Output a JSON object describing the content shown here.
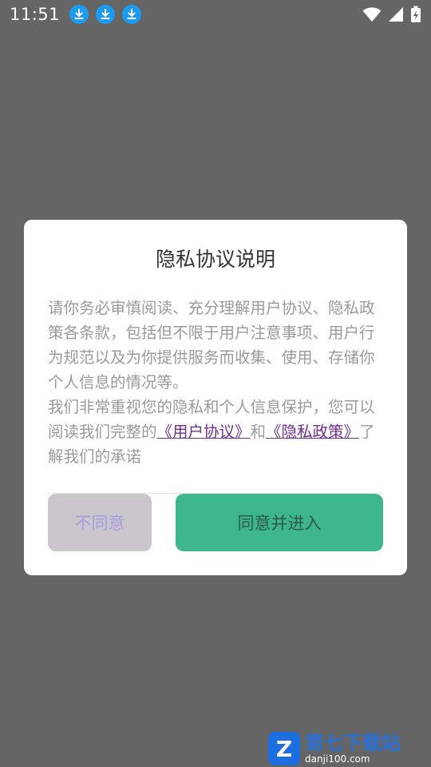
{
  "status_bar": {
    "time": "11:51",
    "notification_icons": [
      "download-icon",
      "download-icon",
      "download-icon"
    ],
    "right_icons": [
      "wifi-icon",
      "signal-icon",
      "battery-charging-icon"
    ]
  },
  "dialog": {
    "title": "隐私协议说明",
    "paragraph1": "请你务必审慎阅读、充分理解用户协议、隐私政策各条款，包括但不限于用户注意事项、用户行为规范以及为你提供服务而收集、使用、存储你个人信息的情况等。",
    "paragraph2_prefix": "我们非常重视您的隐私和个人信息保护，您可以阅读我们完整的",
    "link_user_agreement": "《用户协议》",
    "and_text": "和",
    "link_privacy_policy": "《隐私政策》",
    "paragraph2_suffix": "了解我们的承诺",
    "disagree_label": "不同意",
    "agree_label": "同意并进入"
  },
  "watermark": {
    "logo_letter": "Z",
    "name": "第七下载站",
    "url": "danji100.com"
  },
  "colors": {
    "overlay": "#656565",
    "accent_green": "#3db68c",
    "link_purple": "#6e2f8c",
    "disagree_bg": "#cac6cc"
  }
}
